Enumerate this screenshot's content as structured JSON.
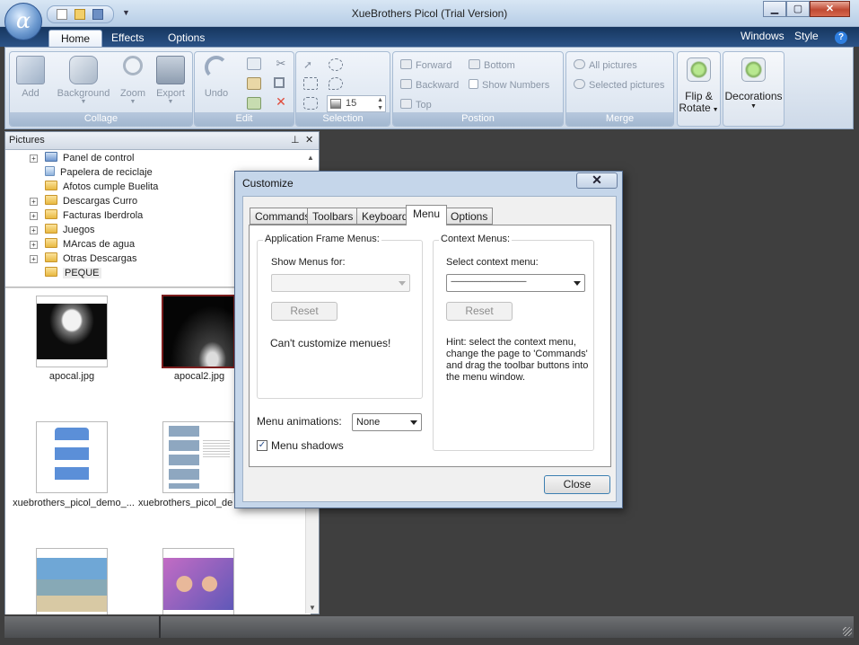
{
  "window": {
    "title": "XueBrothers Picol (Trial Version)",
    "minimize": "▁",
    "maximize": "▢",
    "close": "✕"
  },
  "app": {
    "orb_glyph": "α"
  },
  "ribbon_tabs": [
    "Home",
    "Effects",
    "Options"
  ],
  "ribbon_right": {
    "windows": "Windows",
    "style": "Style",
    "help": "?"
  },
  "groups": {
    "collage": {
      "label": "Collage",
      "add": "Add",
      "background": "Background",
      "zoom": "Zoom",
      "export": "Export"
    },
    "edit": {
      "label": "Edit",
      "undo": "Undo"
    },
    "selection": {
      "label": "Selection",
      "size_value": "15"
    },
    "position": {
      "label": "Postion",
      "forward": "Forward",
      "bottom": "Bottom",
      "backward": "Backward",
      "show_numbers": "Show Numbers",
      "top": "Top"
    },
    "merge": {
      "label": "Merge",
      "all_pictures": "All pictures",
      "selected_pictures": "Selected pictures"
    },
    "flip": {
      "line1": "Flip &",
      "line2": "Rotate"
    },
    "decorations": {
      "label": "Decorations"
    }
  },
  "pictures_panel": {
    "title": "Pictures",
    "pin": "⊥",
    "close": "✕"
  },
  "tree": [
    "Panel de control",
    "Papelera de reciclaje",
    "Afotos cumple Buelita",
    "Descargas Curro",
    "Facturas Iberdrola",
    "Juegos",
    "MArcas de agua",
    "Otras Descargas",
    "PEQUE"
  ],
  "thumbnails": [
    "apocal.jpg",
    "apocal2.jpg",
    "xuebrothers_picol_demo_...",
    "xuebrothers_picol_de"
  ],
  "dialog": {
    "title": "Customize",
    "close_x": "✕",
    "tabs": [
      "Commands",
      "Toolbars",
      "Keyboard",
      "Menu",
      "Options"
    ],
    "app_frame": {
      "legend": "Application Frame Menus:",
      "show_for": "Show Menus for:",
      "reset": "Reset",
      "note": "Can't customize menues!"
    },
    "context": {
      "legend": "Context Menus:",
      "select": "Select context menu:",
      "selected_value": "------------------------------------------",
      "reset": "Reset",
      "hint": "Hint: select the context menu, change the page to 'Commands' and drag the toolbar buttons into the menu window."
    },
    "menu_animations": {
      "label": "Menu animations:",
      "value": "None"
    },
    "menu_shadows": {
      "label": "Menu shadows",
      "checked": "✓"
    },
    "close_button": "Close"
  }
}
